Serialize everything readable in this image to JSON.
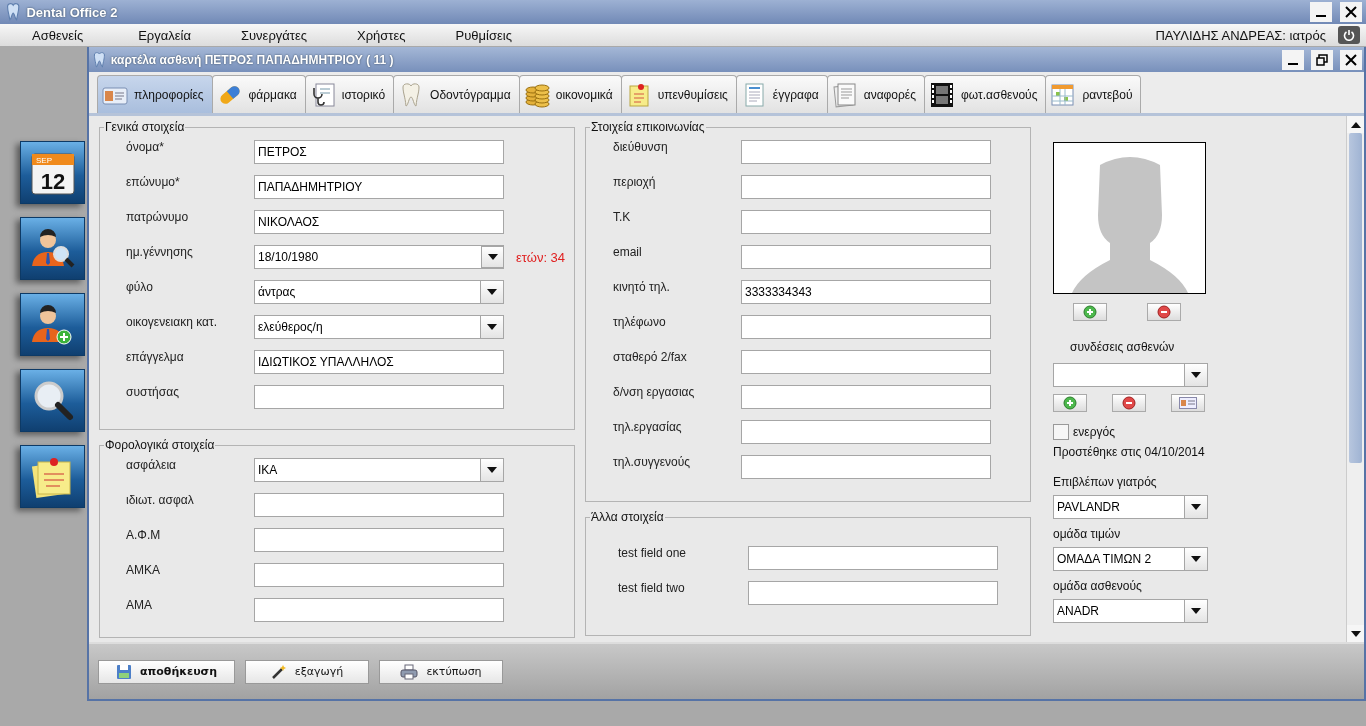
{
  "app": {
    "title": "Dental Office 2",
    "menu": [
      "Ασθενείς",
      "Εργαλεία",
      "Συνεργάτες",
      "Χρήστες",
      "Ρυθμίσεις"
    ],
    "user": "ΠΑΥΛΙΔΗΣ ΑΝΔΡΕΑΣ: ιατρός"
  },
  "launcher": [
    {
      "kind": "calendar",
      "month": "SEP",
      "day": "12"
    },
    {
      "kind": "patient-search"
    },
    {
      "kind": "patient-add"
    },
    {
      "kind": "search"
    },
    {
      "kind": "note"
    }
  ],
  "patient_window": {
    "title": "καρτέλα ασθενή ΠΕΤΡΟΣ ΠΑΠΑΔΗΜΗΤΡΙΟΥ ( 11 )",
    "tabs": [
      {
        "label": "πληροφορίες",
        "kind": "info",
        "selected": true
      },
      {
        "label": "φάρμακα",
        "kind": "pill",
        "selected": false
      },
      {
        "label": "ιστορικό",
        "kind": "history",
        "selected": false
      },
      {
        "label": "Οδοντόγραμμα",
        "kind": "tooth",
        "selected": false
      },
      {
        "label": "οικονομικά",
        "kind": "coins",
        "selected": false
      },
      {
        "label": "υπενθυμίσεις",
        "kind": "note",
        "selected": false
      },
      {
        "label": "έγγραφα",
        "kind": "document",
        "selected": false
      },
      {
        "label": "αναφορές",
        "kind": "report",
        "selected": false
      },
      {
        "label": "φωτ.ασθενούς",
        "kind": "film",
        "selected": false
      },
      {
        "label": "ραντεβού",
        "kind": "calendar",
        "selected": false
      }
    ],
    "general": {
      "title": "Γενικά στοιχεία",
      "fields": [
        {
          "label": "όνομα*",
          "kind": "text",
          "value": "ΠΕΤΡΟΣ"
        },
        {
          "label": "επώνυμο*",
          "kind": "text",
          "value": "ΠΑΠΑΔΗΜΗΤΡΙΟΥ"
        },
        {
          "label": "πατρώνυμο",
          "kind": "text",
          "value": "ΝΙΚΟΛΑΟΣ"
        },
        {
          "label": "ημ.γέννησης",
          "kind": "date",
          "value": "18/10/1980",
          "note": "ετών: 34"
        },
        {
          "label": "φύλο",
          "kind": "select",
          "value": "άντρας"
        },
        {
          "label": "οικογενειακη κατ.",
          "kind": "select",
          "value": "ελεύθερος/η"
        },
        {
          "label": "επάγγελμα",
          "kind": "text",
          "value": "ΙΔΙΩΤΙΚΟΣ ΥΠΑΛΛΗΛΟΣ"
        },
        {
          "label": "συστήσας",
          "kind": "text"
        }
      ]
    },
    "tax": {
      "title": "Φορολογικά στοιχεία",
      "fields": [
        {
          "label": "ασφάλεια",
          "kind": "select",
          "value": "ΙΚΑ"
        },
        {
          "label": "ιδιωτ. ασφαλ",
          "kind": "text"
        },
        {
          "label": "Α.Φ.Μ",
          "kind": "text"
        },
        {
          "label": "ΑΜΚΑ",
          "kind": "text"
        },
        {
          "label": "ΑΜΑ",
          "kind": "text"
        }
      ]
    },
    "contact": {
      "title": "Στοιχεία επικοινωνίας",
      "fields": [
        {
          "label": "διεύθυνση",
          "kind": "text"
        },
        {
          "label": "περιοχή",
          "kind": "text"
        },
        {
          "label": "Τ.Κ",
          "kind": "text"
        },
        {
          "label": "email",
          "kind": "text"
        },
        {
          "label": "κινητό τηλ.",
          "kind": "text",
          "value": "3333334343"
        },
        {
          "label": "τηλέφωνο",
          "kind": "text"
        },
        {
          "label": "σταθερό 2/fax",
          "kind": "text"
        },
        {
          "label": "δ/νση εργασιας",
          "kind": "text"
        },
        {
          "label": "τηλ.εργασίας",
          "kind": "text"
        },
        {
          "label": "τηλ.συγγενούς",
          "kind": "text"
        }
      ]
    },
    "other": {
      "title": "Άλλα στοιχεία",
      "fields": [
        {
          "label": "test field one",
          "kind": "text"
        },
        {
          "label": "test field two",
          "kind": "text"
        }
      ]
    },
    "side": {
      "connections_label": "συνδέσεις ασθενών",
      "active": {
        "label": "ενεργός",
        "checked": false
      },
      "added": "Προστέθηκε στις 04/10/2014",
      "selects": [
        {
          "label": "Επιβλέπων γιατρός",
          "value": "PAVLANDR"
        },
        {
          "label": "ομάδα τιμών",
          "value": "ΟΜΑΔΑ ΤΙΜΩΝ 2"
        },
        {
          "label": "ομάδα ασθενούς",
          "value": "ANADR"
        }
      ]
    },
    "buttons": [
      {
        "label": "αποθήκευση",
        "kind": "save",
        "primary": true
      },
      {
        "label": "εξαγωγή",
        "kind": "export",
        "primary": false
      },
      {
        "label": "εκτύπωση",
        "kind": "print",
        "primary": false
      }
    ]
  }
}
